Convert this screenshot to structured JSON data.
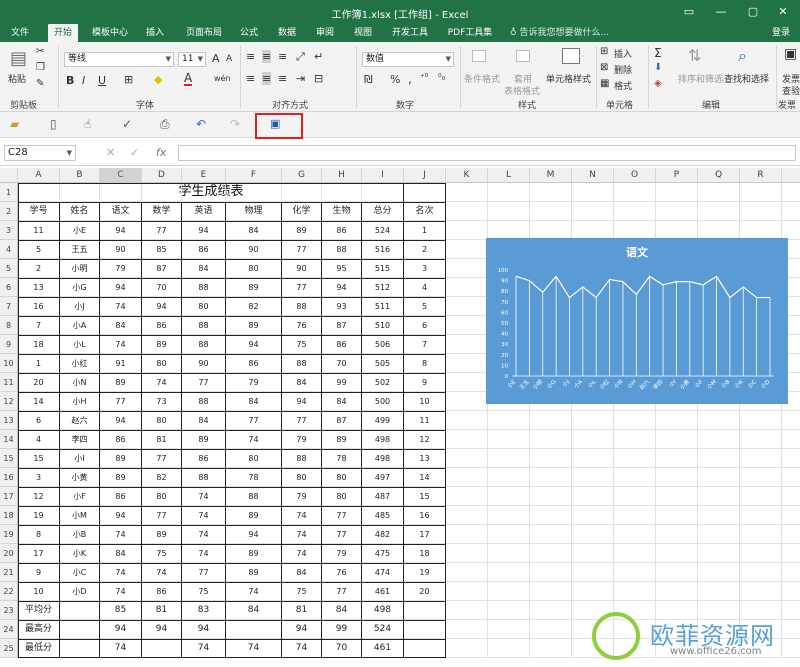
{
  "window": {
    "title": "工作簿1.xlsx  [工作组] - Excel",
    "buttons": [
      "▭",
      "—",
      "▢",
      "✕"
    ]
  },
  "tabs": [
    "文件",
    "开始",
    "模板中心",
    "插入",
    "页面布局",
    "公式",
    "数据",
    "审阅",
    "视图",
    "开发工具",
    "PDF工具集"
  ],
  "active_tab": "开始",
  "tell_me": "告诉我您想要做什么...",
  "login": "登录",
  "ribbon": {
    "clipboard": {
      "paste": "粘贴",
      "label": "剪贴板"
    },
    "font": {
      "name": "等线",
      "size": "11",
      "bold": "B",
      "italic": "I",
      "underline": "U",
      "grow": "A",
      "shrink": "A",
      "color": "A",
      "wen": "wén",
      "label": "字体"
    },
    "alignment": {
      "label": "对齐方式"
    },
    "number": {
      "format": "数值",
      "percent": "%",
      "comma": ",",
      "label": "数字"
    },
    "styles": {
      "conditional": "条件格式",
      "table": "套用",
      "table2": "表格格式",
      "cell_styles": "单元格样式",
      "label": "样式"
    },
    "cells": {
      "insert": "插入",
      "delete": "删除",
      "format": "格式",
      "label": "单元格"
    },
    "editing": {
      "sum": "Σ",
      "sort": "排序和筛选",
      "find": "查找和选择",
      "label": "编辑"
    },
    "publish": {
      "label1": "发票",
      "label2": "查验",
      "label": "发票"
    }
  },
  "namebox": "C28",
  "formula": {
    "cancel": "✕",
    "enter": "✓",
    "fx": "fx"
  },
  "columns": [
    "A",
    "B",
    "C",
    "D",
    "E",
    "F",
    "G",
    "H",
    "I",
    "J",
    "K",
    "L",
    "M",
    "N",
    "O",
    "P",
    "Q",
    "R",
    "S"
  ],
  "selected_column": "C",
  "rows": [
    "1",
    "2",
    "3",
    "4",
    "5",
    "6",
    "7",
    "8",
    "9",
    "10",
    "11",
    "12",
    "13",
    "14",
    "15",
    "16",
    "17",
    "18",
    "19",
    "20",
    "21",
    "22",
    "23",
    "24",
    "25"
  ],
  "sheet": {
    "title": "学生成绩表",
    "headers": [
      "学号",
      "姓名",
      "语文",
      "数学",
      "英语",
      "物理",
      "化学",
      "生物",
      "总分",
      "名次"
    ],
    "records": [
      [
        "11",
        "小E",
        "94",
        "77",
        "94",
        "84",
        "89",
        "86",
        "524",
        "1"
      ],
      [
        "5",
        "王五",
        "90",
        "85",
        "86",
        "90",
        "77",
        "88",
        "516",
        "2"
      ],
      [
        "2",
        "小明",
        "79",
        "87",
        "84",
        "80",
        "90",
        "95",
        "515",
        "3"
      ],
      [
        "13",
        "小G",
        "94",
        "70",
        "88",
        "89",
        "77",
        "94",
        "512",
        "4"
      ],
      [
        "16",
        "小J",
        "74",
        "94",
        "80",
        "82",
        "88",
        "93",
        "511",
        "5"
      ],
      [
        "7",
        "小A",
        "84",
        "86",
        "88",
        "89",
        "76",
        "87",
        "510",
        "6"
      ],
      [
        "18",
        "小L",
        "74",
        "89",
        "88",
        "94",
        "75",
        "86",
        "506",
        "7"
      ],
      [
        "1",
        "小红",
        "91",
        "80",
        "90",
        "86",
        "88",
        "70",
        "505",
        "8"
      ],
      [
        "20",
        "小N",
        "89",
        "74",
        "77",
        "79",
        "84",
        "99",
        "502",
        "9"
      ],
      [
        "14",
        "小H",
        "77",
        "73",
        "88",
        "84",
        "94",
        "84",
        "500",
        "10"
      ],
      [
        "6",
        "赵六",
        "94",
        "80",
        "84",
        "77",
        "77",
        "87",
        "499",
        "11"
      ],
      [
        "4",
        "李四",
        "86",
        "81",
        "89",
        "74",
        "79",
        "89",
        "498",
        "12"
      ],
      [
        "15",
        "小I",
        "89",
        "77",
        "86",
        "80",
        "88",
        "78",
        "498",
        "13"
      ],
      [
        "3",
        "小黄",
        "89",
        "82",
        "88",
        "78",
        "80",
        "80",
        "497",
        "14"
      ],
      [
        "12",
        "小F",
        "86",
        "80",
        "74",
        "88",
        "79",
        "80",
        "487",
        "15"
      ],
      [
        "19",
        "小M",
        "94",
        "77",
        "74",
        "89",
        "74",
        "77",
        "485",
        "16"
      ],
      [
        "8",
        "小B",
        "74",
        "89",
        "74",
        "94",
        "74",
        "77",
        "482",
        "17"
      ],
      [
        "17",
        "小K",
        "84",
        "75",
        "74",
        "89",
        "74",
        "79",
        "475",
        "18"
      ],
      [
        "9",
        "小C",
        "74",
        "74",
        "77",
        "89",
        "84",
        "76",
        "474",
        "19"
      ],
      [
        "10",
        "小D",
        "74",
        "86",
        "75",
        "74",
        "75",
        "77",
        "461",
        "20"
      ]
    ],
    "avg": [
      "平均分",
      "",
      "85",
      "81",
      "83",
      "84",
      "81",
      "84",
      "498",
      ""
    ],
    "max": [
      "最高分",
      "",
      "94",
      "94",
      "94",
      "",
      "94",
      "99",
      "524",
      ""
    ],
    "min": [
      "最低分",
      "",
      "74",
      "",
      "74",
      "74",
      "74",
      "70",
      "461",
      ""
    ]
  },
  "chart_data": {
    "type": "area",
    "title": "语文",
    "categories": [
      "小E",
      "王五",
      "小明",
      "小G",
      "小J",
      "小A",
      "小L",
      "小红",
      "小N",
      "小H",
      "赵六",
      "李四",
      "小I",
      "小黄",
      "小F",
      "小M",
      "小B",
      "小K",
      "小C",
      "小D"
    ],
    "values": [
      94,
      90,
      79,
      94,
      74,
      84,
      74,
      91,
      89,
      77,
      94,
      86,
      89,
      89,
      86,
      94,
      74,
      84,
      74,
      74
    ],
    "yticks": [
      "0",
      "10",
      "20",
      "30",
      "40",
      "50",
      "60",
      "70",
      "80",
      "90",
      "100"
    ],
    "ylim": [
      0,
      100
    ],
    "background": "#5b9bd5",
    "fill": "#5b9bd5",
    "line": "#ffffff"
  },
  "watermark": {
    "text": "欧菲资源网",
    "url": "www.office26.com"
  }
}
